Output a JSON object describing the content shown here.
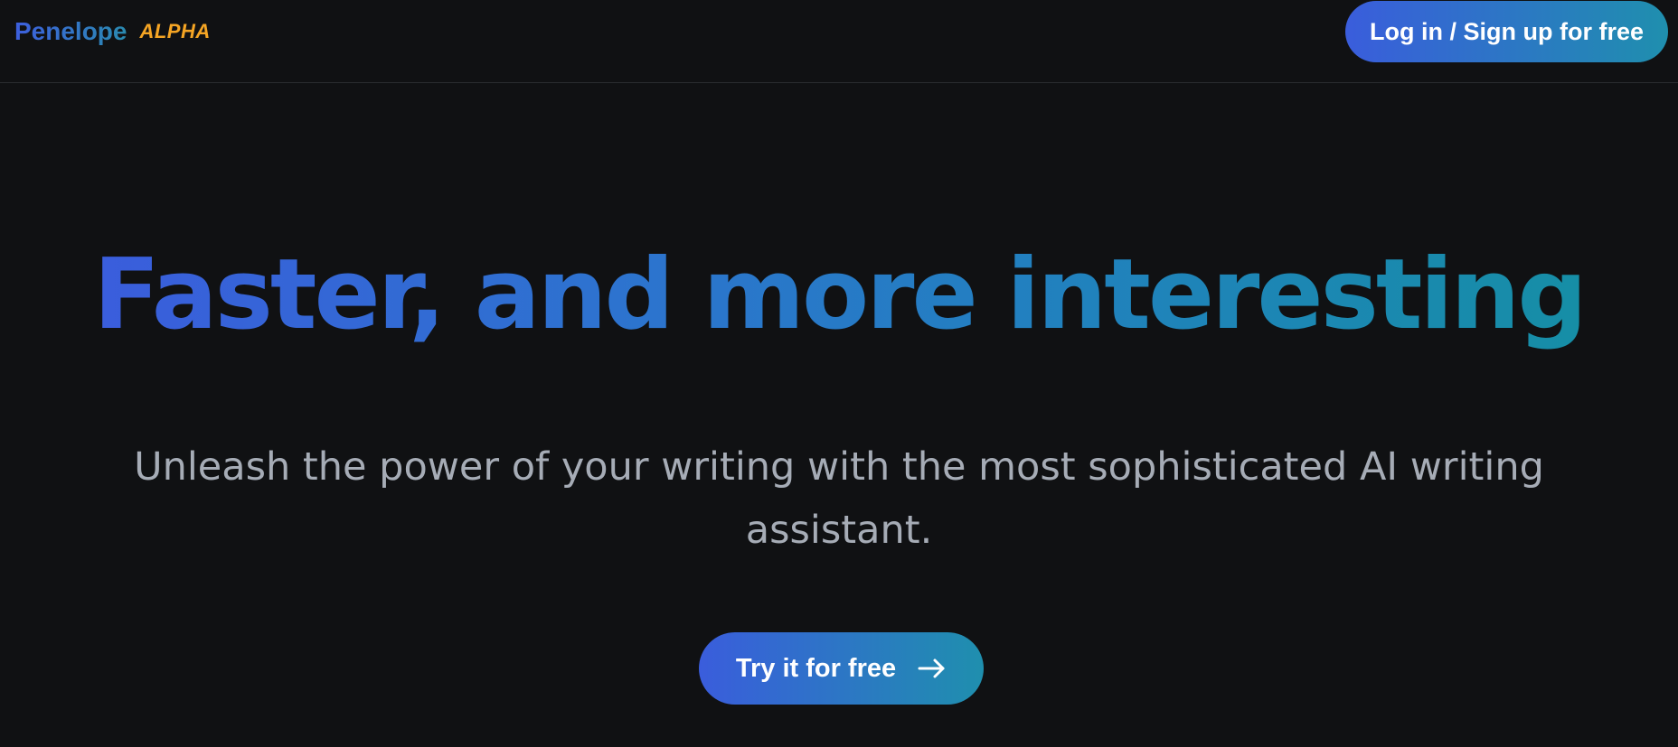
{
  "header": {
    "brand_name": "Penelope",
    "brand_badge": "ALPHA",
    "login_label": "Log in / Sign up for free"
  },
  "hero": {
    "headline": "Faster, and more interesting",
    "subheadline": "Unleash the power of your writing with the most sophisticated AI writing assistant.",
    "cta_label": "Try it for free",
    "cta_icon": "arrow-right-icon"
  },
  "colors": {
    "background": "#101113",
    "gradient_start": "#3a5ddc",
    "gradient_end": "#1f8fae",
    "badge": "#f5a524",
    "subtext": "#a6acb6"
  }
}
